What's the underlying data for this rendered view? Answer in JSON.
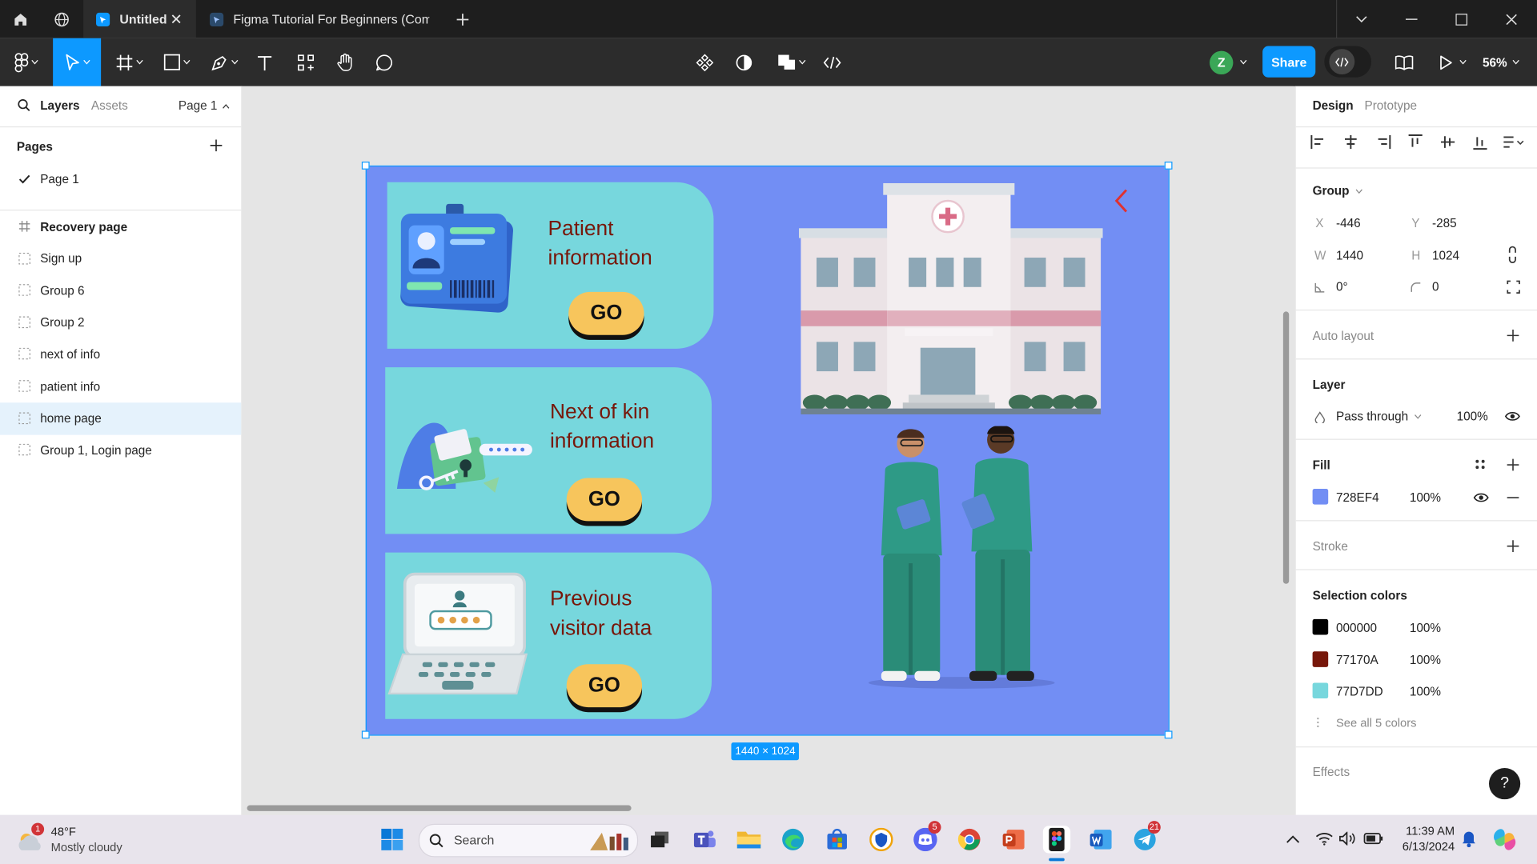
{
  "tabs": [
    {
      "label": "Untitled",
      "active": true
    },
    {
      "label": "Figma Tutorial For Beginners (Comm",
      "active": false
    }
  ],
  "toolbar": {
    "share_label": "Share",
    "zoom": "56%",
    "avatar_initial": "Z"
  },
  "left_panel": {
    "tabs": [
      "Layers",
      "Assets"
    ],
    "page_selector": "Page 1",
    "pages_title": "Pages",
    "pages": [
      "Page 1"
    ],
    "layers": [
      {
        "name": "Recovery page",
        "kind": "frame",
        "selected": false
      },
      {
        "name": "Sign up",
        "kind": "group",
        "selected": false
      },
      {
        "name": "Group 6",
        "kind": "group",
        "selected": false
      },
      {
        "name": "Group 2",
        "kind": "group",
        "selected": false
      },
      {
        "name": "next of info",
        "kind": "group",
        "selected": false
      },
      {
        "name": "patient info",
        "kind": "group",
        "selected": false
      },
      {
        "name": "home page",
        "kind": "group",
        "selected": true
      },
      {
        "name": "Group 1, Login page",
        "kind": "group",
        "selected": false
      }
    ]
  },
  "canvas": {
    "cards": [
      {
        "title": "Patient\ninformation",
        "button": "GO"
      },
      {
        "title": "Next of kin\ninformation",
        "button": "GO"
      },
      {
        "title": "Previous\nvisitor data",
        "button": "GO"
      }
    ],
    "size_label": "1440 × 1024",
    "frame_color": "#728EF4",
    "card_color": "#77D7DD"
  },
  "right_panel": {
    "tabs": [
      "Design",
      "Prototype"
    ],
    "group_label": "Group",
    "x_label": "X",
    "x": "-446",
    "y_label": "Y",
    "y": "-285",
    "w_label": "W",
    "w": "1440",
    "h_label": "H",
    "h": "1024",
    "rotation": "0°",
    "radius": "0",
    "auto_layout": "Auto layout",
    "layer_title": "Layer",
    "blend_mode": "Pass through",
    "layer_opacity": "100%",
    "fill_title": "Fill",
    "fill": {
      "hex": "728EF4",
      "opacity": "100%",
      "color": "#728EF4"
    },
    "stroke_title": "Stroke",
    "selection_colors_title": "Selection colors",
    "selection_colors": [
      {
        "hex": "000000",
        "opacity": "100%",
        "color": "#000000"
      },
      {
        "hex": "77170A",
        "opacity": "100%",
        "color": "#77170A"
      },
      {
        "hex": "77D7DD",
        "opacity": "100%",
        "color": "#77D7DD"
      }
    ],
    "see_all": "See all 5 colors",
    "effects_title": "Effects"
  },
  "taskbar": {
    "weather_temp": "48°F",
    "weather_desc": "Mostly cloudy",
    "weather_badge": "1",
    "search_placeholder": "Search",
    "time": "11:39 AM",
    "date": "6/13/2024",
    "discord_badge": "5",
    "telegram_badge": "21"
  },
  "help_label": "?"
}
